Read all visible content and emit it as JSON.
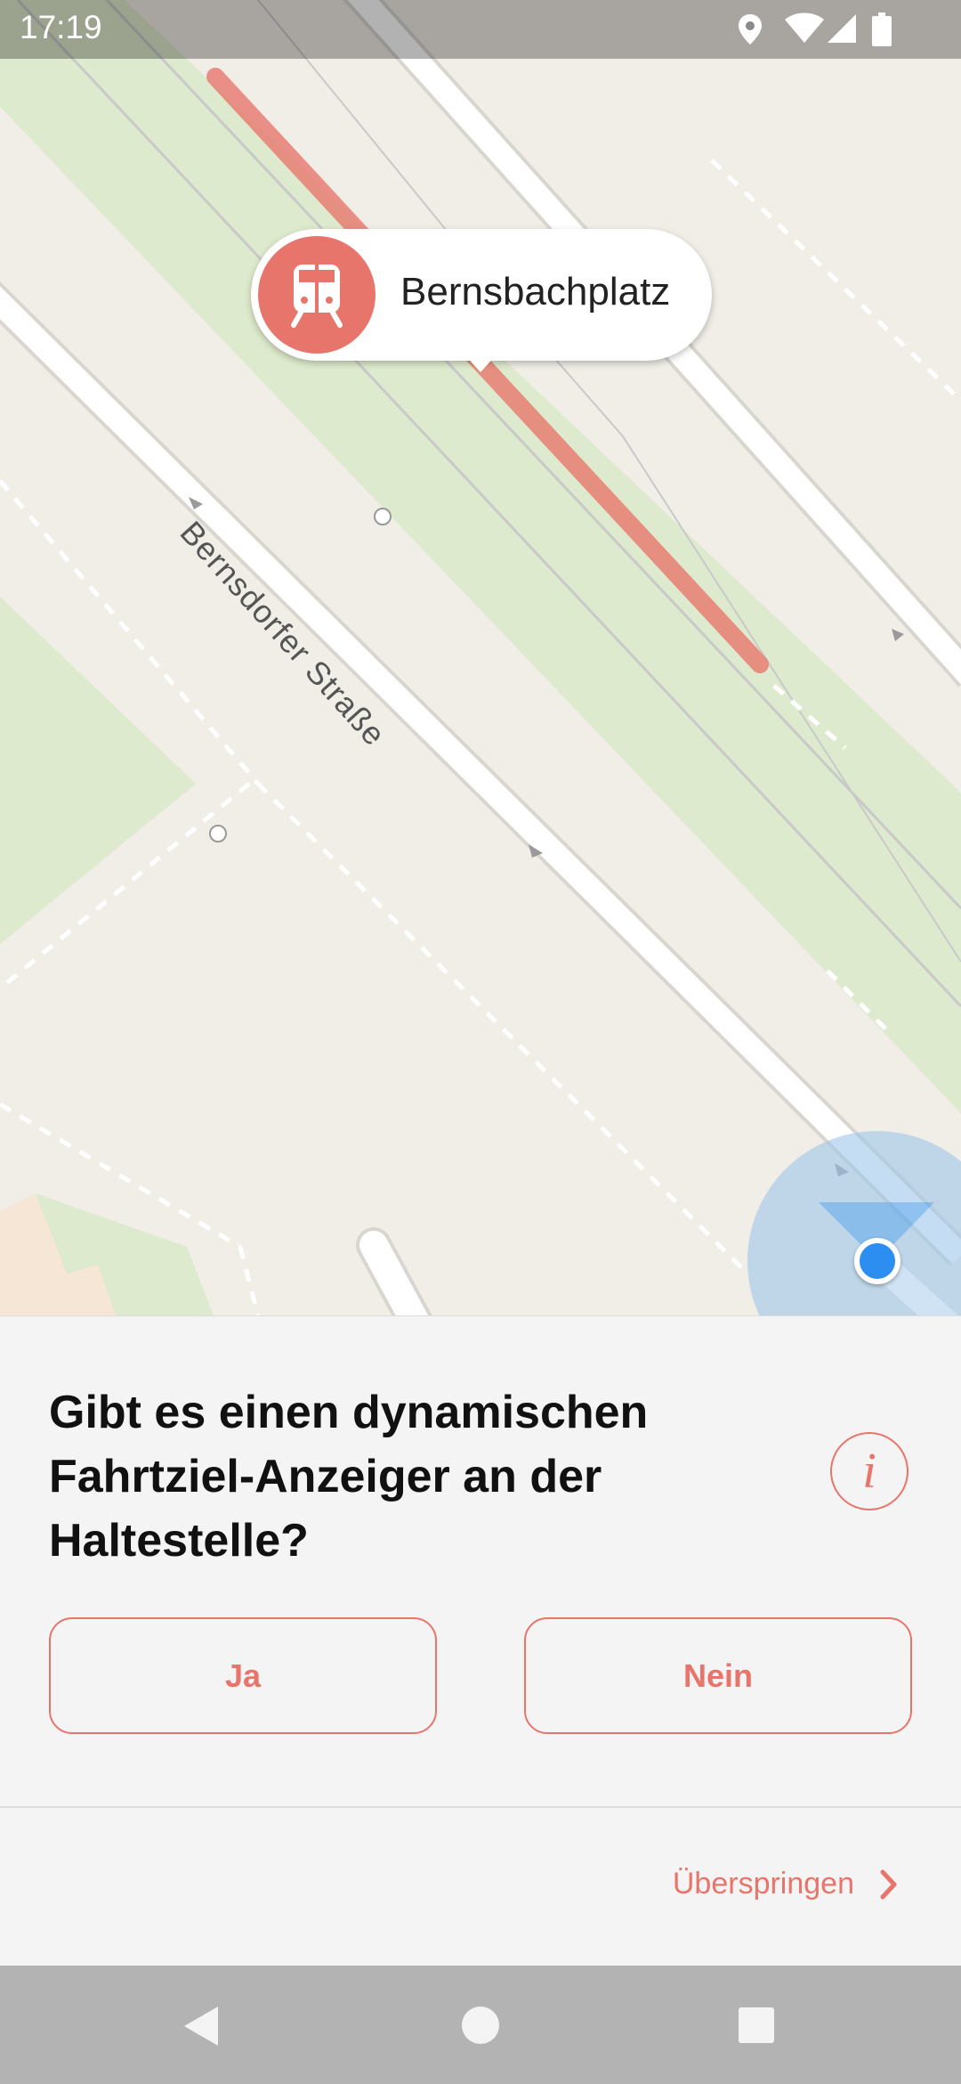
{
  "status_bar": {
    "time": "17:19",
    "icons": [
      "location-icon",
      "wifi-icon",
      "signal-icon",
      "battery-icon"
    ]
  },
  "map": {
    "stop_name": "Bernsbachplatz",
    "stop_icon": "tram-icon",
    "street_name": "Bernsdorfer Straße",
    "highlight_color": "#e8756b",
    "location_color": "#2b8ef0"
  },
  "quest": {
    "question": "Gibt es einen dynamischen Fahrtziel-Anzeiger an der Haltestelle?",
    "info_icon": "i",
    "yes_label": "Ja",
    "no_label": "Nein",
    "skip_label": "Überspringen"
  },
  "nav_bar": {
    "buttons": [
      "back-icon",
      "home-icon",
      "recents-icon"
    ]
  },
  "colors": {
    "accent": "#e8756b",
    "sheet_background": "#f4f4f4",
    "map_background": "#f1ede7",
    "park": "#deeacd"
  }
}
